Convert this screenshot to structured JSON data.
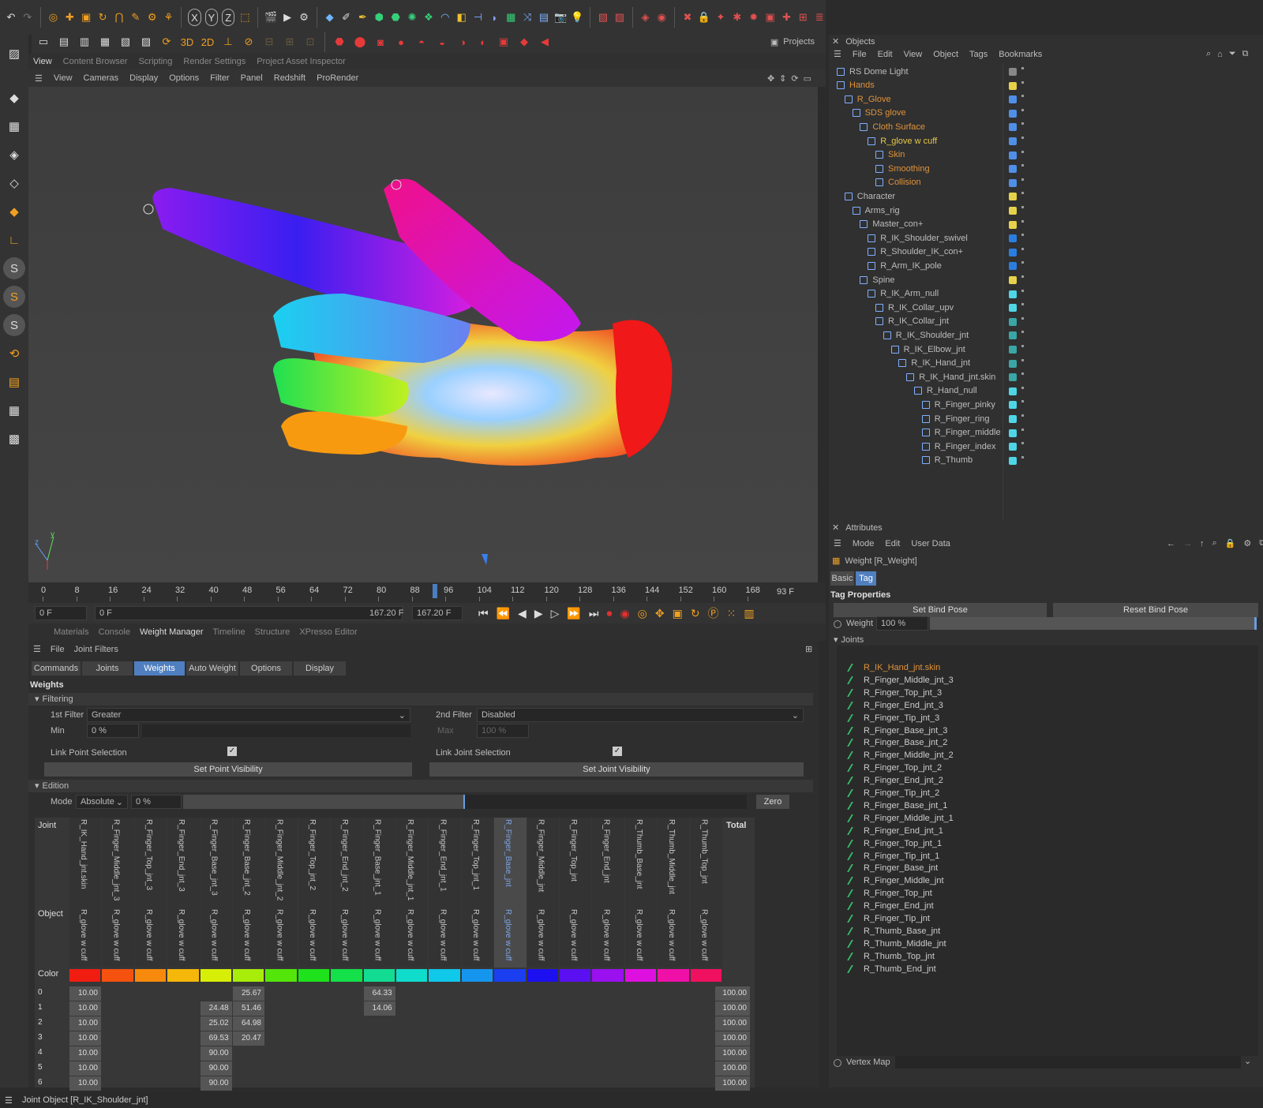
{
  "toolbar": {
    "x": "X",
    "y": "Y",
    "z": "Z",
    "projects": "Projects"
  },
  "layout_tabs": [
    "View",
    "Content Browser",
    "Scripting",
    "Render Settings",
    "Project Asset Inspector"
  ],
  "viewport_menu": [
    "View",
    "Cameras",
    "Display",
    "Options",
    "Filter",
    "Panel",
    "Redshift",
    "ProRender"
  ],
  "timeline": {
    "ticks": [
      "0",
      "8",
      "16",
      "24",
      "32",
      "40",
      "48",
      "56",
      "64",
      "72",
      "80",
      "88",
      "96",
      "104",
      "112",
      "120",
      "128",
      "136",
      "144",
      "152",
      "160",
      "168"
    ],
    "current_marker": "93 F",
    "frame_now": "0 F",
    "frame_start": "0 F",
    "frame_end_a": "167.20 F",
    "frame_end_b": "167.20 F"
  },
  "bottom_tabs": [
    "Materials",
    "Console",
    "Weight Manager",
    "Timeline",
    "Structure",
    "XPresso Editor"
  ],
  "wm": {
    "menu_file": "File",
    "menu_joint_filters": "Joint Filters",
    "tabs": [
      "Commands",
      "Joints",
      "Weights",
      "Auto Weight",
      "Options",
      "Display"
    ],
    "section_weights": "Weights",
    "filtering": "Filtering",
    "first_filter_label": "1st Filter",
    "first_filter_value": "Greater",
    "second_filter_label": "2nd Filter",
    "second_filter_value": "Disabled",
    "min_label": "Min",
    "min_value": "0 %",
    "max_label": "Max",
    "max_value": "100 %",
    "link_point": "Link Point Selection",
    "link_joint": "Link Joint Selection",
    "set_point_vis": "Set Point Visibility",
    "set_joint_vis": "Set Joint Visibility",
    "edition": "Edition",
    "mode_label": "Mode",
    "mode_value": "Absolute",
    "mode_pct": "0 %",
    "zero": "Zero",
    "joint_label": "Joint",
    "object_label": "Object",
    "color_label": "Color",
    "total_label": "Total"
  },
  "joints": [
    "R_IK_Hand_jnt.skin",
    "R_Finger_Middle_jnt_3",
    "R_Finger_Top_jnt_3",
    "R_Finger_End_jnt_3",
    "R_Finger_Base_jnt_3",
    "R_Finger_Base_jnt_2",
    "R_Finger_Middle_jnt_2",
    "R_Finger_Top_jnt_2",
    "R_Finger_End_jnt_2",
    "R_Finger_Base_jnt_1",
    "R_Finger_Middle_jnt_1",
    "R_Finger_End_jnt_1",
    "R_Finger_Top_jnt_1",
    "R_Finger_Base_jnt",
    "R_Finger_Middle_jnt",
    "R_Finger_Top_jnt",
    "R_Finger_End_jnt",
    "R_Thumb_Base_jnt",
    "R_Thumb_Middle_jnt",
    "R_Thumb_Top_jnt"
  ],
  "object_name": "R_glove w cuff",
  "colors": [
    "#f01d10",
    "#f5520f",
    "#f78a0c",
    "#f5b70a",
    "#d7ef07",
    "#a8ec0a",
    "#54e60b",
    "#1ee21c",
    "#14e04a",
    "#12dc92",
    "#10dccc",
    "#10c8ea",
    "#1695ee",
    "#1b3ef0",
    "#1d10f0",
    "#5a10f0",
    "#9a10ee",
    "#de10e0",
    "#ef10a8",
    "#f01060"
  ],
  "weight_rows": [
    {
      "idx": "0",
      "vals": {
        "0": "10.00",
        "5": "25.67",
        "9": "64.33"
      },
      "total": "100.00"
    },
    {
      "idx": "1",
      "vals": {
        "0": "10.00",
        "4": "24.48",
        "5": "51.46",
        "9": "14.06"
      },
      "total": "100.00"
    },
    {
      "idx": "2",
      "vals": {
        "0": "10.00",
        "4": "25.02",
        "5": "64.98"
      },
      "total": "100.00"
    },
    {
      "idx": "3",
      "vals": {
        "0": "10.00",
        "4": "69.53",
        "5": "20.47"
      },
      "total": "100.00"
    },
    {
      "idx": "4",
      "vals": {
        "0": "10.00",
        "4": "90.00"
      },
      "total": "100.00"
    },
    {
      "idx": "5",
      "vals": {
        "0": "10.00",
        "4": "90.00"
      },
      "total": "100.00"
    },
    {
      "idx": "6",
      "vals": {
        "0": "10.00",
        "4": "90.00"
      },
      "total": "100.00"
    }
  ],
  "objects_panel": {
    "title": "Objects",
    "menu": [
      "File",
      "Edit",
      "View",
      "Object",
      "Tags",
      "Bookmarks"
    ],
    "tree": [
      {
        "name": "RS Dome Light",
        "depth": 0,
        "cls": "",
        "color": "#888"
      },
      {
        "name": "Hands",
        "depth": 0,
        "cls": "orange",
        "color": "#e6d24a"
      },
      {
        "name": "R_Glove",
        "depth": 1,
        "cls": "orange",
        "color": "#4f8fe8"
      },
      {
        "name": "SDS glove",
        "depth": 2,
        "cls": "orange",
        "color": "#4f8fe8"
      },
      {
        "name": "Cloth Surface",
        "depth": 3,
        "cls": "orange",
        "color": "#4f8fe8"
      },
      {
        "name": "R_glove w cuff",
        "depth": 4,
        "cls": "yellowt",
        "color": "#4f8fe8"
      },
      {
        "name": "Skin",
        "depth": 5,
        "cls": "orange",
        "color": "#4f8fe8"
      },
      {
        "name": "Smoothing",
        "depth": 5,
        "cls": "orange",
        "color": "#4f8fe8"
      },
      {
        "name": "Collision",
        "depth": 5,
        "cls": "orange",
        "color": "#4f8fe8"
      },
      {
        "name": "Character",
        "depth": 1,
        "cls": "",
        "color": "#e6d24a"
      },
      {
        "name": "Arms_rig",
        "depth": 2,
        "cls": "",
        "color": "#e6d24a"
      },
      {
        "name": "Master_con+",
        "depth": 3,
        "cls": "",
        "color": "#e6d24a"
      },
      {
        "name": "R_IK_Shoulder_swivel",
        "depth": 4,
        "cls": "",
        "color": "#2a7ee0"
      },
      {
        "name": "R_Shoulder_IK_con+",
        "depth": 4,
        "cls": "",
        "color": "#2a7ee0"
      },
      {
        "name": "R_Arm_IK_pole",
        "depth": 4,
        "cls": "",
        "color": "#2a7ee0"
      },
      {
        "name": "Spine",
        "depth": 3,
        "cls": "",
        "color": "#e6d24a"
      },
      {
        "name": "R_IK_Arm_null",
        "depth": 4,
        "cls": "",
        "color": "#4fd6e6"
      },
      {
        "name": "R_IK_Collar_upv",
        "depth": 5,
        "cls": "",
        "color": "#4fd6e6"
      },
      {
        "name": "R_IK_Collar_jnt",
        "depth": 5,
        "cls": "",
        "color": "#3aa6a6"
      },
      {
        "name": "R_IK_Shoulder_jnt",
        "depth": 6,
        "cls": "",
        "color": "#3aa6a6"
      },
      {
        "name": "R_IK_Elbow_jnt",
        "depth": 7,
        "cls": "",
        "color": "#3aa6a6"
      },
      {
        "name": "R_IK_Hand_jnt",
        "depth": 8,
        "cls": "",
        "color": "#3aa6a6"
      },
      {
        "name": "R_IK_Hand_jnt.skin",
        "depth": 9,
        "cls": "",
        "color": "#3aa6a6"
      },
      {
        "name": "R_Hand_null",
        "depth": 10,
        "cls": "",
        "color": "#4fd6e6"
      },
      {
        "name": "R_Finger_pinky",
        "depth": 11,
        "cls": "",
        "color": "#4fd6e6"
      },
      {
        "name": "R_Finger_ring",
        "depth": 11,
        "cls": "",
        "color": "#4fd6e6"
      },
      {
        "name": "R_Finger_middle",
        "depth": 11,
        "cls": "",
        "color": "#4fd6e6"
      },
      {
        "name": "R_Finger_index",
        "depth": 11,
        "cls": "",
        "color": "#4fd6e6"
      },
      {
        "name": "R_Thumb",
        "depth": 11,
        "cls": "",
        "color": "#4fd6e6"
      }
    ]
  },
  "attributes": {
    "title": "Attributes",
    "menu": [
      "Mode",
      "Edit",
      "User Data"
    ],
    "object": "Weight [R_Weight]",
    "tab_basic": "Basic",
    "tab_tag": "Tag",
    "tag_props": "Tag Properties",
    "set_bind": "Set Bind Pose",
    "reset_bind": "Reset Bind Pose",
    "weight_label": "Weight",
    "weight_value": "100 %",
    "joints_header": "Joints",
    "vertex_map": "Vertex Map",
    "joint_list": [
      "R_IK_Hand_jnt.skin",
      "R_Finger_Middle_jnt_3",
      "R_Finger_Top_jnt_3",
      "R_Finger_End_jnt_3",
      "R_Finger_Tip_jnt_3",
      "R_Finger_Base_jnt_3",
      "R_Finger_Base_jnt_2",
      "R_Finger_Middle_jnt_2",
      "R_Finger_Top_jnt_2",
      "R_Finger_End_jnt_2",
      "R_Finger_Tip_jnt_2",
      "R_Finger_Base_jnt_1",
      "R_Finger_Middle_jnt_1",
      "R_Finger_End_jnt_1",
      "R_Finger_Top_jnt_1",
      "R_Finger_Tip_jnt_1",
      "R_Finger_Base_jnt",
      "R_Finger_Middle_jnt",
      "R_Finger_Top_jnt",
      "R_Finger_End_jnt",
      "R_Finger_Tip_jnt",
      "R_Thumb_Base_jnt",
      "R_Thumb_Middle_jnt",
      "R_Thumb_Top_jnt",
      "R_Thumb_End_jnt"
    ]
  },
  "status": "Joint Object [R_IK_Shoulder_jnt]"
}
